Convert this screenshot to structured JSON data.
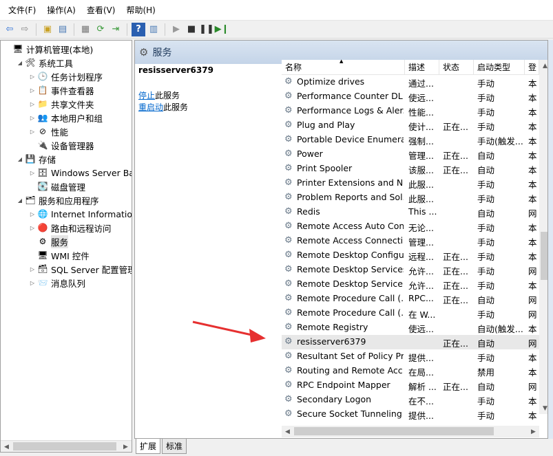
{
  "menu": [
    "文件(F)",
    "操作(A)",
    "查看(V)",
    "帮助(H)"
  ],
  "tree": [
    {
      "label": "计算机管理(本地)",
      "level": 0,
      "exp": "",
      "icon": "computer-icon",
      "glyph": "🖥"
    },
    {
      "label": "系统工具",
      "level": 1,
      "exp": "◢",
      "icon": "tools-icon",
      "glyph": "🛠"
    },
    {
      "label": "任务计划程序",
      "level": 2,
      "exp": "▷",
      "icon": "clock-icon",
      "glyph": "🕒"
    },
    {
      "label": "事件查看器",
      "level": 2,
      "exp": "▷",
      "icon": "event-icon",
      "glyph": "📋"
    },
    {
      "label": "共享文件夹",
      "level": 2,
      "exp": "▷",
      "icon": "folder-icon",
      "glyph": "📁"
    },
    {
      "label": "本地用户和组",
      "level": 2,
      "exp": "▷",
      "icon": "users-icon",
      "glyph": "👥"
    },
    {
      "label": "性能",
      "level": 2,
      "exp": "▷",
      "icon": "performance-icon",
      "glyph": "⊘"
    },
    {
      "label": "设备管理器",
      "level": 2,
      "exp": "",
      "icon": "device-icon",
      "glyph": "🔌"
    },
    {
      "label": "存储",
      "level": 1,
      "exp": "◢",
      "icon": "storage-icon",
      "glyph": "💾"
    },
    {
      "label": "Windows Server Back",
      "level": 2,
      "exp": "▷",
      "icon": "backup-icon",
      "glyph": "🗄"
    },
    {
      "label": "磁盘管理",
      "level": 2,
      "exp": "",
      "icon": "disk-icon",
      "glyph": "💽"
    },
    {
      "label": "服务和应用程序",
      "level": 1,
      "exp": "◢",
      "icon": "apps-icon",
      "glyph": "🗂"
    },
    {
      "label": "Internet Information S",
      "level": 2,
      "exp": "▷",
      "icon": "iis-icon",
      "glyph": "🌐"
    },
    {
      "label": "路由和远程访问",
      "level": 2,
      "exp": "▷",
      "icon": "routing-icon",
      "glyph": "🔴"
    },
    {
      "label": "服务",
      "level": 2,
      "exp": "",
      "icon": "services-gear-icon",
      "glyph": "⚙",
      "selected": true
    },
    {
      "label": "WMI 控件",
      "level": 2,
      "exp": "",
      "icon": "wmi-icon",
      "glyph": "🖥"
    },
    {
      "label": "SQL Server 配置管理器",
      "level": 2,
      "exp": "▷",
      "icon": "sql-icon",
      "glyph": "🗃"
    },
    {
      "label": "消息队列",
      "level": 2,
      "exp": "▷",
      "icon": "queue-icon",
      "glyph": "📨"
    }
  ],
  "panel": {
    "title": "服务",
    "service": "resisserver6379",
    "link_stop": "停止",
    "link_stop_suffix": "此服务",
    "link_restart": "重启动",
    "link_restart_suffix": "此服务"
  },
  "columns": [
    "名称",
    "描述",
    "状态",
    "启动类型",
    "登"
  ],
  "services": [
    {
      "name": "Optimize drives",
      "desc": "通过...",
      "status": "",
      "startup": "手动",
      "logon": "本"
    },
    {
      "name": "Performance Counter DL...",
      "desc": "使远...",
      "status": "",
      "startup": "手动",
      "logon": "本"
    },
    {
      "name": "Performance Logs & Aler...",
      "desc": "性能...",
      "status": "",
      "startup": "手动",
      "logon": "本"
    },
    {
      "name": "Plug and Play",
      "desc": "使计...",
      "status": "正在...",
      "startup": "手动",
      "logon": "本"
    },
    {
      "name": "Portable Device Enumera...",
      "desc": "强制...",
      "status": "",
      "startup": "手动(触发...",
      "logon": "本"
    },
    {
      "name": "Power",
      "desc": "管理...",
      "status": "正在...",
      "startup": "自动",
      "logon": "本"
    },
    {
      "name": "Print Spooler",
      "desc": "该服...",
      "status": "正在...",
      "startup": "自动",
      "logon": "本"
    },
    {
      "name": "Printer Extensions and N...",
      "desc": "此服...",
      "status": "",
      "startup": "手动",
      "logon": "本"
    },
    {
      "name": "Problem Reports and Sol...",
      "desc": "此服...",
      "status": "",
      "startup": "手动",
      "logon": "本"
    },
    {
      "name": "Redis",
      "desc": "This ...",
      "status": "",
      "startup": "自动",
      "logon": "网"
    },
    {
      "name": "Remote Access Auto Con...",
      "desc": "无论...",
      "status": "",
      "startup": "手动",
      "logon": "本"
    },
    {
      "name": "Remote Access Connecti...",
      "desc": "管理...",
      "status": "",
      "startup": "手动",
      "logon": "本"
    },
    {
      "name": "Remote Desktop Configu...",
      "desc": "远程...",
      "status": "正在...",
      "startup": "手动",
      "logon": "本"
    },
    {
      "name": "Remote Desktop Services",
      "desc": "允许...",
      "status": "正在...",
      "startup": "手动",
      "logon": "网"
    },
    {
      "name": "Remote Desktop Service...",
      "desc": "允许...",
      "status": "正在...",
      "startup": "手动",
      "logon": "本"
    },
    {
      "name": "Remote Procedure Call (...",
      "desc": "RPC...",
      "status": "正在...",
      "startup": "自动",
      "logon": "网"
    },
    {
      "name": "Remote Procedure Call (...",
      "desc": "在 W...",
      "status": "",
      "startup": "手动",
      "logon": "网"
    },
    {
      "name": "Remote Registry",
      "desc": "使远...",
      "status": "",
      "startup": "自动(触发...",
      "logon": "本"
    },
    {
      "name": "resisserver6379",
      "desc": "",
      "status": "正在...",
      "startup": "自动",
      "logon": "网",
      "selected": true
    },
    {
      "name": "Resultant Set of Policy Pr...",
      "desc": "提供...",
      "status": "",
      "startup": "手动",
      "logon": "本"
    },
    {
      "name": "Routing and Remote Acc...",
      "desc": "在局...",
      "status": "",
      "startup": "禁用",
      "logon": "本"
    },
    {
      "name": "RPC Endpoint Mapper",
      "desc": "解析 ...",
      "status": "正在...",
      "startup": "自动",
      "logon": "网"
    },
    {
      "name": "Secondary Logon",
      "desc": "在不...",
      "status": "",
      "startup": "手动",
      "logon": "本"
    },
    {
      "name": "Secure Socket Tunneling ...",
      "desc": "提供...",
      "status": "",
      "startup": "手动",
      "logon": "本"
    }
  ],
  "tabs": [
    "扩展",
    "标准"
  ],
  "accent": "#e63030"
}
